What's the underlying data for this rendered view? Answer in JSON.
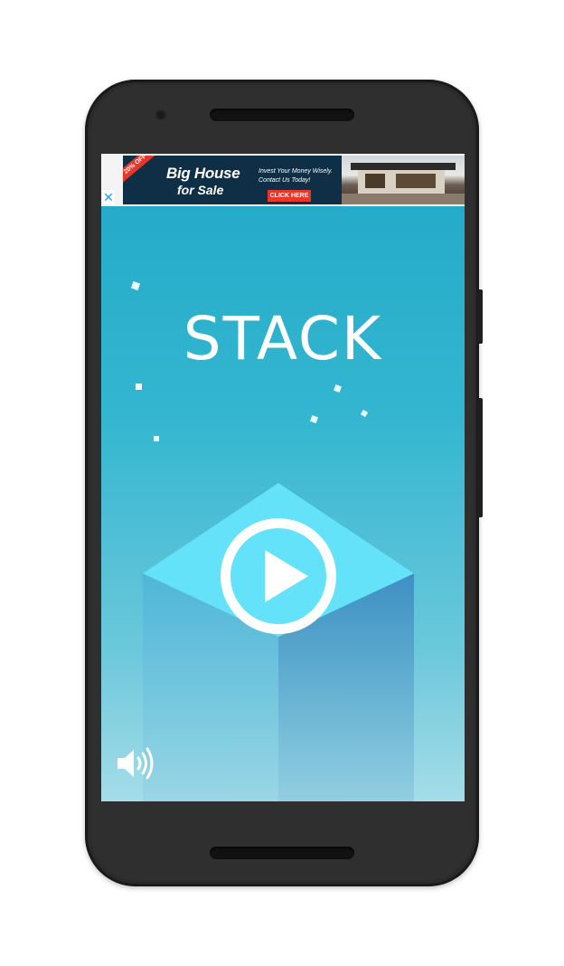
{
  "ad": {
    "close_symbol": "✕",
    "ribbon": "20% OFF",
    "title_line1": "Big House",
    "title_line2": "for Sale",
    "tagline1": "Invest Your Money Wisely.",
    "tagline2": "Contact Us Today!",
    "cta": "CLICK HERE"
  },
  "game": {
    "title": "STACK",
    "play_icon": "play-icon",
    "sound_icon": "speaker-icon"
  },
  "colors": {
    "phone_body": "#2a2a2a",
    "sky_top": "#25abc9",
    "sky_bottom": "#a5dde8",
    "cube_top": "#63e2f9",
    "cube_left": "#4fb6d8",
    "cube_right": "#3e8fc3",
    "ad_red": "#e8362a"
  }
}
